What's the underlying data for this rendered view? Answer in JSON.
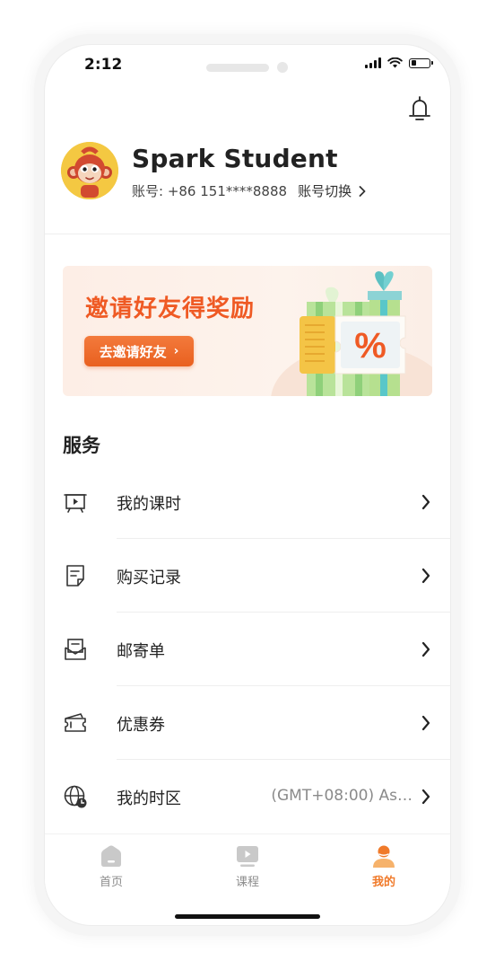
{
  "status_bar": {
    "time": "2:12",
    "battery_level": 0.25
  },
  "profile": {
    "name": "Spark Student",
    "account_label": "账号: +86 151****8888",
    "switch_label": "账号切换"
  },
  "banner": {
    "title": "邀请好友得奖励",
    "button_label": "去邀请好友",
    "ticket_symbol": "%"
  },
  "services": {
    "title": "服务",
    "items": [
      {
        "label": "我的课时",
        "value": "",
        "icon": "lesson-board-icon"
      },
      {
        "label": "购买记录",
        "value": "",
        "icon": "purchase-record-icon"
      },
      {
        "label": "邮寄单",
        "value": "",
        "icon": "mail-order-icon"
      },
      {
        "label": "优惠券",
        "value": "",
        "icon": "coupon-icon"
      },
      {
        "label": "我的时区",
        "value": "(GMT+08:00) As…",
        "icon": "timezone-globe-icon"
      }
    ]
  },
  "tabbar": {
    "tabs": [
      {
        "label": "首页",
        "icon": "home-icon",
        "active": false
      },
      {
        "label": "课程",
        "icon": "course-play-icon",
        "active": false
      },
      {
        "label": "我的",
        "icon": "profile-person-icon",
        "active": true
      }
    ]
  },
  "colors": {
    "accent": "#f07a2a",
    "banner_title": "#ef5a24",
    "inactive": "#8c8c8c"
  }
}
